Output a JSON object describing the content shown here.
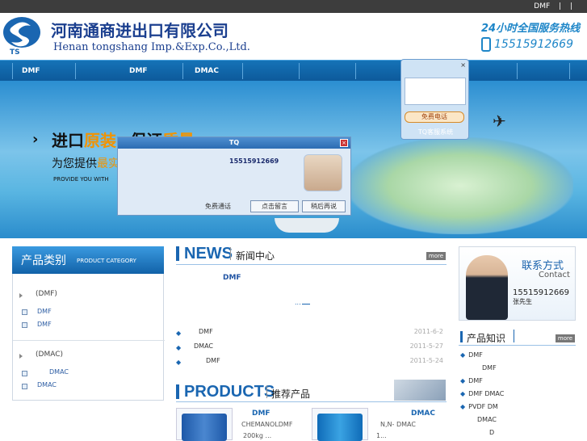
{
  "topbar": {
    "items": [
      "DMF",
      "|",
      "|"
    ]
  },
  "header": {
    "logo_text": "TS",
    "company_cn": "河南通商进出口有限公司",
    "company_en": "Henan tongshang Imp.&Exp.Co.,Ltd.",
    "hotline_label": "24小时全国服务热线",
    "hotline_number": "15515912669"
  },
  "nav": {
    "items": [
      "DMF",
      "DMF",
      "DMAC"
    ]
  },
  "banner": {
    "line1_a": "进口",
    "line1_b": "原装",
    "line1_c": "保证",
    "line1_d": "质量",
    "line2_a": "为您提供",
    "line2_b": "最实",
    "line3": "PROVIDE YOU WITH"
  },
  "tq_popup": {
    "title": "TQ",
    "phone": "15515912669",
    "free_call": "免费通话",
    "btn_leave_msg": "点击留言",
    "btn_later": "稍后再说"
  },
  "tq_side": {
    "close": "×",
    "free_call": "免费电话",
    "label": "TQ客服系统"
  },
  "category": {
    "title": "产品类别",
    "title_en": "PRODUCT CATEGORY",
    "groups": [
      {
        "label": "(DMF)",
        "items": [
          "DMF",
          "DMF"
        ]
      },
      {
        "label": "(DMAC)",
        "items": [
          "DMAC",
          "DMAC"
        ]
      }
    ]
  },
  "news": {
    "title": "NEWS",
    "subtitle": "新闻中心",
    "more": "more",
    "featured": "DMF",
    "featured_link": "...",
    "items": [
      {
        "title": "DMF",
        "date": "2011-6-2"
      },
      {
        "title": "DMAC",
        "date": "2011-5-27"
      },
      {
        "title": "DMF",
        "date": "2011-5-24"
      }
    ]
  },
  "products": {
    "title": "PRODUCTS",
    "subtitle": "推荐产品",
    "items": [
      {
        "name": "DMF",
        "desc1": "CHEMANOLDMF",
        "desc2": "200kg ..."
      },
      {
        "name": "DMAC",
        "desc1": "N,N-  DMAC",
        "desc2": "1..."
      }
    ]
  },
  "contact": {
    "title": "联系方式",
    "title_en": "Contact",
    "phone": "15515912669",
    "person": "张先生"
  },
  "knowledge": {
    "title": "产品知识",
    "more": "more",
    "items": [
      "DMF",
      "DMF",
      "DMF",
      "DMF DMAC",
      "PVDF   DM",
      "DMAC",
      "D"
    ]
  }
}
